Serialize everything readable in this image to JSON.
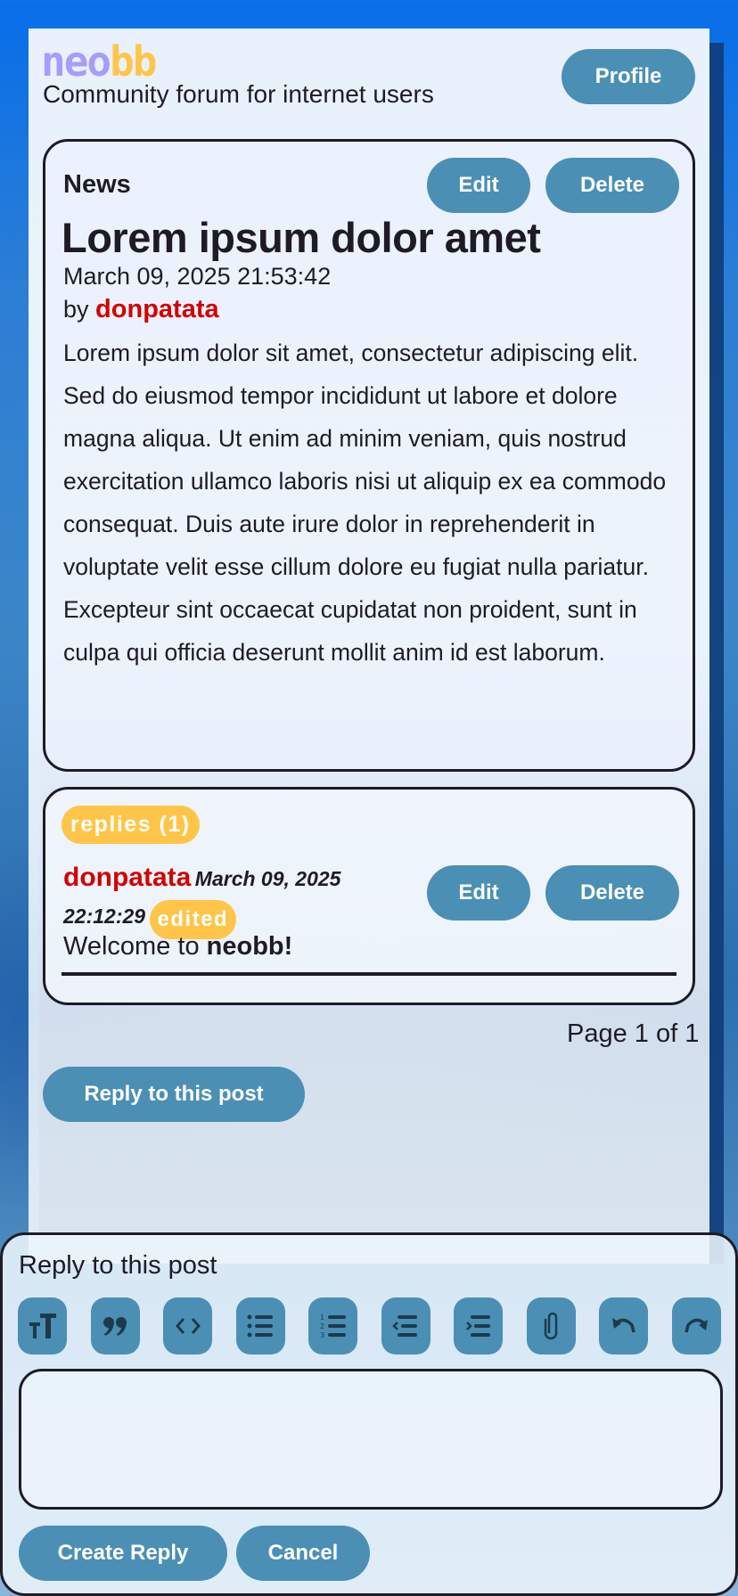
{
  "site": {
    "logo_part1": "neo",
    "logo_part2": "bb",
    "tagline": "Community forum for internet users",
    "profile_label": "Profile",
    "colors": {
      "accent": "#4b8fb4",
      "logo_purple": "#a89cf9",
      "logo_yellow": "#fec548",
      "author_red": "#d30000",
      "badge": "#fec548"
    }
  },
  "post": {
    "category": "News",
    "edit_label": "Edit",
    "delete_label": "Delete",
    "title": "Lorem ipsum dolor amet",
    "date": "March 09, 2025 21:53:42",
    "by_label": "by",
    "author": "donpatata",
    "body": "Lorem ipsum dolor sit amet, consectetur adipiscing elit. Sed do eiusmod tempor incididunt ut labore et dolore magna aliqua. Ut enim ad minim veniam, quis nostrud exercitation ullamco laboris nisi ut aliquip ex ea commodo consequat. Duis aute irure dolor in reprehenderit in voluptate velit esse cillum dolore eu fugiat nulla pariatur. Excepteur sint occaecat cupidatat non proident, sunt in culpa qui officia deserunt mollit anim id est laborum."
  },
  "replies": {
    "badge": "replies (1)",
    "items": [
      {
        "author": "donpatata",
        "date": "March 09, 2025 22:12:29",
        "edited_label": "edited",
        "content_prefix": "Welcome to",
        "content_bold": "neobb!",
        "edit_label": "Edit",
        "delete_label": "Delete"
      }
    ]
  },
  "pagination": {
    "text": "Page 1 of 1"
  },
  "reply_button_label": "Reply to this post",
  "reply_form": {
    "title": "Reply to this post",
    "toolbar": [
      {
        "icon": "text-size-icon",
        "tooltip": "Text size"
      },
      {
        "icon": "quote-icon",
        "tooltip": "Quote"
      },
      {
        "icon": "code-icon",
        "tooltip": "Code"
      },
      {
        "icon": "bullet-list-icon",
        "tooltip": "Bullet list"
      },
      {
        "icon": "numbered-list-icon",
        "tooltip": "Numbered list"
      },
      {
        "icon": "outdent-icon",
        "tooltip": "Outdent"
      },
      {
        "icon": "indent-icon",
        "tooltip": "Indent"
      },
      {
        "icon": "attachment-icon",
        "tooltip": "Attach"
      },
      {
        "icon": "undo-icon",
        "tooltip": "Undo"
      },
      {
        "icon": "redo-icon",
        "tooltip": "Redo"
      }
    ],
    "editor_value": "",
    "editor_placeholder": "",
    "create_label": "Create Reply",
    "cancel_label": "Cancel"
  }
}
